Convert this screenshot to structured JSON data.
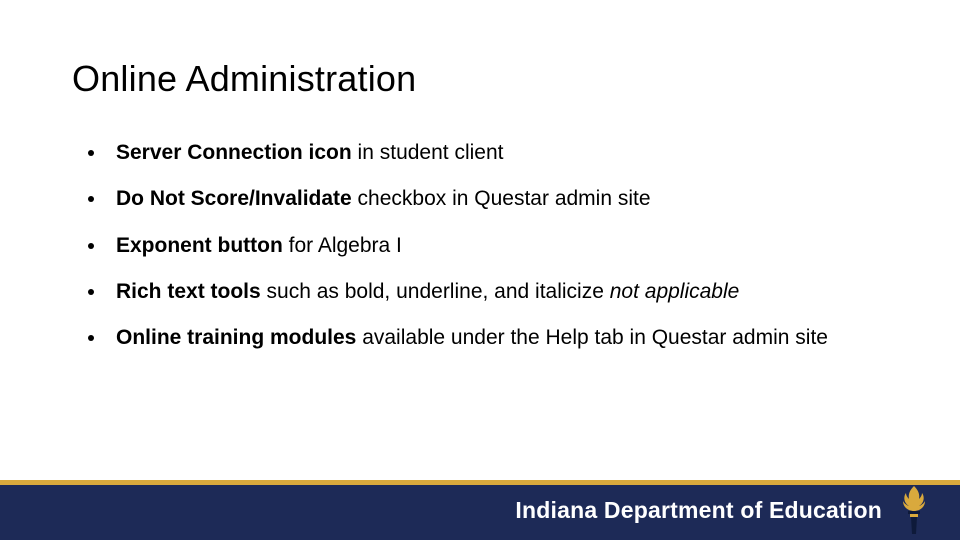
{
  "title": "Online Administration",
  "bullets": [
    {
      "bold": "Server Connection icon",
      "rest": " in student client"
    },
    {
      "bold": "Do Not Score/Invalidate",
      "rest": " checkbox in Questar admin site"
    },
    {
      "bold": "Exponent button",
      "rest": " for Algebra I"
    },
    {
      "bold": "Rich text tools",
      "rest": " such as bold, underline, and italicize ",
      "italic": "not applicable"
    },
    {
      "bold": "Online training modules",
      "rest": " available under the Help tab in Questar admin site"
    }
  ],
  "footer": {
    "org": "Indiana Department of Education"
  }
}
